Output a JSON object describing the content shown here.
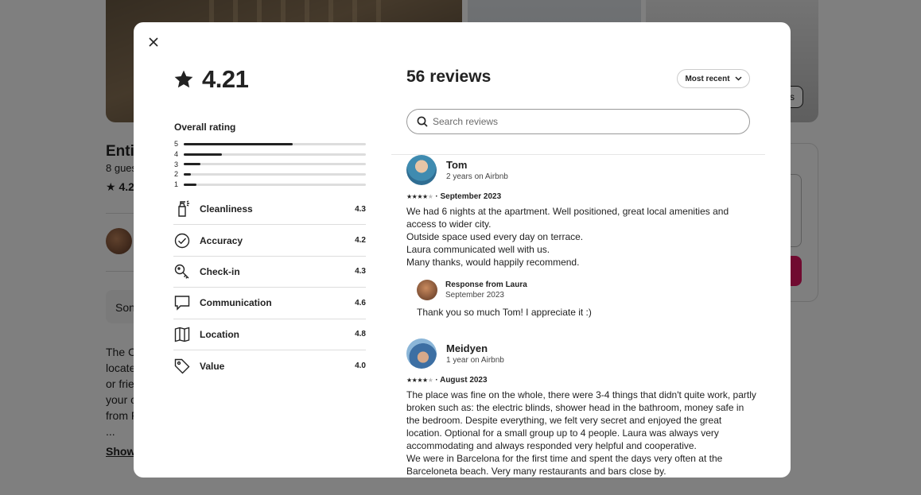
{
  "background": {
    "listing_title": "Enti",
    "guests": "8 gues",
    "rating": "4.2",
    "show_all_label": "s",
    "some_box": "Son",
    "desc_lines": [
      "The C",
      "locate",
      "or frie",
      "your c",
      "from F",
      "..."
    ],
    "show_more": "Show"
  },
  "modal": {
    "close_icon": "close-icon",
    "overall_score": "4.21",
    "overall_label": "Overall rating",
    "distribution": [
      {
        "stars": "5",
        "fraction": 0.6
      },
      {
        "stars": "4",
        "fraction": 0.21
      },
      {
        "stars": "3",
        "fraction": 0.09
      },
      {
        "stars": "2",
        "fraction": 0.04
      },
      {
        "stars": "1",
        "fraction": 0.07
      }
    ],
    "categories": [
      {
        "name": "Cleanliness",
        "score": "4.3",
        "icon": "spray-bottle-icon"
      },
      {
        "name": "Accuracy",
        "score": "4.2",
        "icon": "check-circle-icon"
      },
      {
        "name": "Check-in",
        "score": "4.3",
        "icon": "key-icon"
      },
      {
        "name": "Communication",
        "score": "4.6",
        "icon": "chat-bubble-icon"
      },
      {
        "name": "Location",
        "score": "4.8",
        "icon": "map-icon"
      },
      {
        "name": "Value",
        "score": "4.0",
        "icon": "tag-icon"
      }
    ],
    "reviews_count": "56 reviews",
    "sort_label": "Most recent",
    "search_placeholder": "Search reviews",
    "reviews": [
      {
        "name": "Tom",
        "tenure": "2 years on Airbnb",
        "stars": 4,
        "date": "· September 2023",
        "lines": [
          "We had 6 nights at the apartment. Well positioned, great local amenities and access to wider city.",
          "Outside space used every day on terrace.",
          "Laura communicated well with us.",
          "Many thanks, would happily recommend."
        ],
        "response": {
          "title": "Response from Laura",
          "date": "September 2023",
          "text": "Thank you so much Tom! I appreciate it :)"
        }
      },
      {
        "name": "Meidyen",
        "tenure": "1 year on Airbnb",
        "stars": 4,
        "date": "· August 2023",
        "lines": [
          "The place was fine on the whole, there were 3-4 things that didn't quite work, partly broken such as: the electric blinds, shower head in the bathroom, money safe in the bedroom. Despite everything, we felt very secret and enjoyed the great location. Optional for a small group up to 4 people. Laura was always very accommodating and always responded very helpful and cooperative.",
          "We were in Barcelona for the first time and spent the days very often at the Barceloneta beach. Very many restaurants and bars close by."
        ]
      }
    ]
  }
}
